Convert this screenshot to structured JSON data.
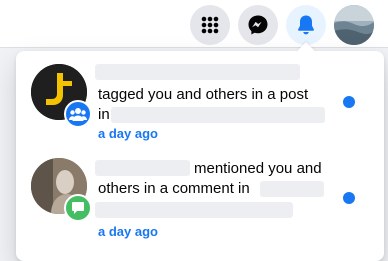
{
  "header": {
    "menu_icon": "grid-menu-icon",
    "messenger_icon": "messenger-icon",
    "notifications_icon": "bell-icon"
  },
  "notifications": [
    {
      "action_text": "tagged you and others in a post",
      "preposition": "in",
      "time": "a day ago",
      "badge_icon": "group-icon",
      "badge_color": "#1877f2",
      "unread": true
    },
    {
      "action_text": "mentioned you and",
      "action_text_2": "others in a comment in",
      "time": "a day ago",
      "badge_icon": "comment-icon",
      "badge_color": "#45bd62",
      "unread": true
    }
  ],
  "colors": {
    "accent": "#1877f2",
    "comment_badge": "#45bd62",
    "text": "#050505"
  }
}
